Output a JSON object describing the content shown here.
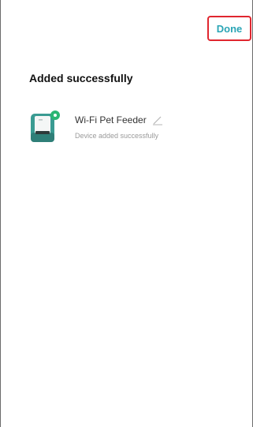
{
  "header": {
    "done_label": "Done"
  },
  "page": {
    "title": "Added successfully"
  },
  "device": {
    "name": "Wi-Fi Pet Feeder",
    "status": "Device added successfully",
    "icon": "pet-feeder-icon",
    "edit_icon": "edit-pencil-icon"
  },
  "colors": {
    "accent": "#2aa5b5",
    "highlight_border": "#e0262f",
    "device_teal": "#3a9b92",
    "status_dot": "#2bb673"
  }
}
